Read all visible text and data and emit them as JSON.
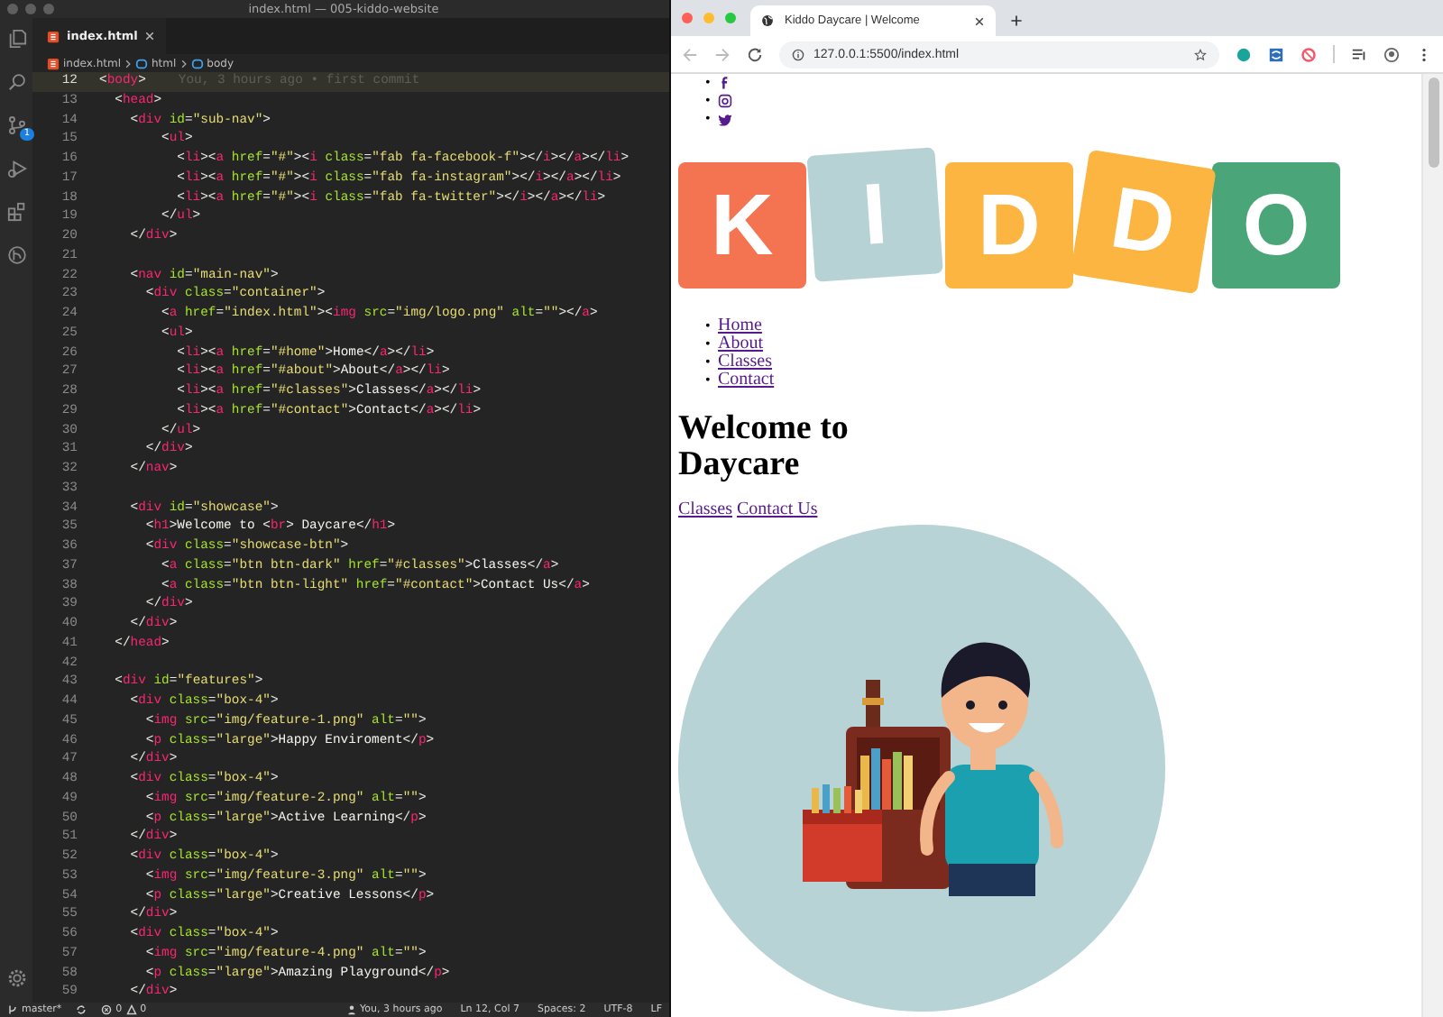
{
  "editor": {
    "window_title": "index.html — 005-kiddo-website",
    "tabs": [
      {
        "label": "index.html",
        "selected": true
      }
    ],
    "breadcrumb": [
      "index.html",
      "html",
      "body"
    ],
    "scm_badge": "1",
    "blame": "You, 3 hours ago • first commit",
    "lines": [
      {
        "number": "12",
        "current": true,
        "tokens": [
          {
            "kind": "punct",
            "text": "<"
          },
          {
            "kind": "tag",
            "text": "body"
          },
          {
            "kind": "punct",
            "text": ">"
          }
        ]
      },
      {
        "number": "13",
        "current": false,
        "tokens": [
          {
            "kind": "punct",
            "text": "  <"
          },
          {
            "kind": "tag",
            "text": "head"
          },
          {
            "kind": "punct",
            "text": ">"
          }
        ]
      },
      {
        "number": "14",
        "current": false,
        "tokens": [
          {
            "kind": "punct",
            "text": "    <"
          },
          {
            "kind": "tag",
            "text": "div"
          },
          {
            "kind": "attr",
            "text": " id"
          },
          {
            "kind": "punct",
            "text": "="
          },
          {
            "kind": "string",
            "text": "\"sub-nav\""
          },
          {
            "kind": "punct",
            "text": ">"
          }
        ]
      },
      {
        "number": "15",
        "current": false,
        "tokens": [
          {
            "kind": "punct",
            "text": "        <"
          },
          {
            "kind": "tag",
            "text": "ul"
          },
          {
            "kind": "punct",
            "text": ">"
          }
        ]
      },
      {
        "number": "16",
        "current": false,
        "tokens": [
          {
            "kind": "punct",
            "text": "          <"
          },
          {
            "kind": "tag",
            "text": "li"
          },
          {
            "kind": "punct",
            "text": "><"
          },
          {
            "kind": "tag",
            "text": "a"
          },
          {
            "kind": "attr",
            "text": " href"
          },
          {
            "kind": "punct",
            "text": "="
          },
          {
            "kind": "string",
            "text": "\"#\""
          },
          {
            "kind": "punct",
            "text": "><"
          },
          {
            "kind": "tag",
            "text": "i"
          },
          {
            "kind": "attr",
            "text": " class"
          },
          {
            "kind": "punct",
            "text": "="
          },
          {
            "kind": "string",
            "text": "\"fab fa-facebook-f\""
          },
          {
            "kind": "punct",
            "text": "></"
          },
          {
            "kind": "tag",
            "text": "i"
          },
          {
            "kind": "punct",
            "text": "></"
          },
          {
            "kind": "tag",
            "text": "a"
          },
          {
            "kind": "punct",
            "text": "></"
          },
          {
            "kind": "tag",
            "text": "li"
          },
          {
            "kind": "punct",
            "text": ">"
          }
        ]
      },
      {
        "number": "17",
        "current": false,
        "tokens": [
          {
            "kind": "punct",
            "text": "          <"
          },
          {
            "kind": "tag",
            "text": "li"
          },
          {
            "kind": "punct",
            "text": "><"
          },
          {
            "kind": "tag",
            "text": "a"
          },
          {
            "kind": "attr",
            "text": " href"
          },
          {
            "kind": "punct",
            "text": "="
          },
          {
            "kind": "string",
            "text": "\"#\""
          },
          {
            "kind": "punct",
            "text": "><"
          },
          {
            "kind": "tag",
            "text": "i"
          },
          {
            "kind": "attr",
            "text": " class"
          },
          {
            "kind": "punct",
            "text": "="
          },
          {
            "kind": "string",
            "text": "\"fab fa-instagram\""
          },
          {
            "kind": "punct",
            "text": "></"
          },
          {
            "kind": "tag",
            "text": "i"
          },
          {
            "kind": "punct",
            "text": "></"
          },
          {
            "kind": "tag",
            "text": "a"
          },
          {
            "kind": "punct",
            "text": "></"
          },
          {
            "kind": "tag",
            "text": "li"
          },
          {
            "kind": "punct",
            "text": ">"
          }
        ]
      },
      {
        "number": "18",
        "current": false,
        "tokens": [
          {
            "kind": "punct",
            "text": "          <"
          },
          {
            "kind": "tag",
            "text": "li"
          },
          {
            "kind": "punct",
            "text": "><"
          },
          {
            "kind": "tag",
            "text": "a"
          },
          {
            "kind": "attr",
            "text": " href"
          },
          {
            "kind": "punct",
            "text": "="
          },
          {
            "kind": "string",
            "text": "\"#\""
          },
          {
            "kind": "punct",
            "text": "><"
          },
          {
            "kind": "tag",
            "text": "i"
          },
          {
            "kind": "attr",
            "text": " class"
          },
          {
            "kind": "punct",
            "text": "="
          },
          {
            "kind": "string",
            "text": "\"fab fa-twitter\""
          },
          {
            "kind": "punct",
            "text": "></"
          },
          {
            "kind": "tag",
            "text": "i"
          },
          {
            "kind": "punct",
            "text": "></"
          },
          {
            "kind": "tag",
            "text": "a"
          },
          {
            "kind": "punct",
            "text": "></"
          },
          {
            "kind": "tag",
            "text": "li"
          },
          {
            "kind": "punct",
            "text": ">"
          }
        ]
      },
      {
        "number": "19",
        "current": false,
        "tokens": [
          {
            "kind": "punct",
            "text": "        </"
          },
          {
            "kind": "tag",
            "text": "ul"
          },
          {
            "kind": "punct",
            "text": ">"
          }
        ]
      },
      {
        "number": "20",
        "current": false,
        "tokens": [
          {
            "kind": "punct",
            "text": "    </"
          },
          {
            "kind": "tag",
            "text": "div"
          },
          {
            "kind": "punct",
            "text": ">"
          }
        ]
      },
      {
        "number": "21",
        "current": false
      },
      {
        "number": "22",
        "current": false,
        "tokens": [
          {
            "kind": "punct",
            "text": "    <"
          },
          {
            "kind": "tag",
            "text": "nav"
          },
          {
            "kind": "attr",
            "text": " id"
          },
          {
            "kind": "punct",
            "text": "="
          },
          {
            "kind": "string",
            "text": "\"main-nav\""
          },
          {
            "kind": "punct",
            "text": ">"
          }
        ]
      },
      {
        "number": "23",
        "current": false,
        "tokens": [
          {
            "kind": "punct",
            "text": "      <"
          },
          {
            "kind": "tag",
            "text": "div"
          },
          {
            "kind": "attr",
            "text": " class"
          },
          {
            "kind": "punct",
            "text": "="
          },
          {
            "kind": "string",
            "text": "\"container\""
          },
          {
            "kind": "punct",
            "text": ">"
          }
        ]
      },
      {
        "number": "24",
        "current": false,
        "tokens": [
          {
            "kind": "punct",
            "text": "        <"
          },
          {
            "kind": "tag",
            "text": "a"
          },
          {
            "kind": "attr",
            "text": " href"
          },
          {
            "kind": "punct",
            "text": "="
          },
          {
            "kind": "string",
            "text": "\""
          },
          {
            "kind": "link",
            "text": "index.html"
          },
          {
            "kind": "string",
            "text": "\""
          },
          {
            "kind": "punct",
            "text": "><"
          },
          {
            "kind": "tag",
            "text": "img"
          },
          {
            "kind": "attr",
            "text": " src"
          },
          {
            "kind": "punct",
            "text": "="
          },
          {
            "kind": "string",
            "text": "\""
          },
          {
            "kind": "link",
            "text": "img/logo.png"
          },
          {
            "kind": "string",
            "text": "\""
          },
          {
            "kind": "attr",
            "text": " alt"
          },
          {
            "kind": "punct",
            "text": "="
          },
          {
            "kind": "string",
            "text": "\"\""
          },
          {
            "kind": "punct",
            "text": "></"
          },
          {
            "kind": "tag",
            "text": "a"
          },
          {
            "kind": "punct",
            "text": ">"
          }
        ]
      },
      {
        "number": "25",
        "current": false,
        "tokens": [
          {
            "kind": "punct",
            "text": "        <"
          },
          {
            "kind": "tag",
            "text": "ul"
          },
          {
            "kind": "punct",
            "text": ">"
          }
        ]
      },
      {
        "number": "26",
        "current": false,
        "tokens": [
          {
            "kind": "punct",
            "text": "          <"
          },
          {
            "kind": "tag",
            "text": "li"
          },
          {
            "kind": "punct",
            "text": "><"
          },
          {
            "kind": "tag",
            "text": "a"
          },
          {
            "kind": "attr",
            "text": " href"
          },
          {
            "kind": "punct",
            "text": "="
          },
          {
            "kind": "string",
            "text": "\""
          },
          {
            "kind": "link",
            "text": "#home"
          },
          {
            "kind": "string",
            "text": "\""
          },
          {
            "kind": "punct",
            "text": ">"
          },
          {
            "kind": "text",
            "text": "Home"
          },
          {
            "kind": "punct",
            "text": "</"
          },
          {
            "kind": "tag",
            "text": "a"
          },
          {
            "kind": "punct",
            "text": "></"
          },
          {
            "kind": "tag",
            "text": "li"
          },
          {
            "kind": "punct",
            "text": ">"
          }
        ]
      },
      {
        "number": "27",
        "current": false,
        "tokens": [
          {
            "kind": "punct",
            "text": "          <"
          },
          {
            "kind": "tag",
            "text": "li"
          },
          {
            "kind": "punct",
            "text": "><"
          },
          {
            "kind": "tag",
            "text": "a"
          },
          {
            "kind": "attr",
            "text": " href"
          },
          {
            "kind": "punct",
            "text": "="
          },
          {
            "kind": "string",
            "text": "\""
          },
          {
            "kind": "link",
            "text": "#about"
          },
          {
            "kind": "string",
            "text": "\""
          },
          {
            "kind": "punct",
            "text": ">"
          },
          {
            "kind": "text",
            "text": "About"
          },
          {
            "kind": "punct",
            "text": "</"
          },
          {
            "kind": "tag",
            "text": "a"
          },
          {
            "kind": "punct",
            "text": "></"
          },
          {
            "kind": "tag",
            "text": "li"
          },
          {
            "kind": "punct",
            "text": ">"
          }
        ]
      },
      {
        "number": "28",
        "current": false,
        "tokens": [
          {
            "kind": "punct",
            "text": "          <"
          },
          {
            "kind": "tag",
            "text": "li"
          },
          {
            "kind": "punct",
            "text": "><"
          },
          {
            "kind": "tag",
            "text": "a"
          },
          {
            "kind": "attr",
            "text": " href"
          },
          {
            "kind": "punct",
            "text": "="
          },
          {
            "kind": "string",
            "text": "\""
          },
          {
            "kind": "link",
            "text": "#classes"
          },
          {
            "kind": "string",
            "text": "\""
          },
          {
            "kind": "punct",
            "text": ">"
          },
          {
            "kind": "text",
            "text": "Classes"
          },
          {
            "kind": "punct",
            "text": "</"
          },
          {
            "kind": "tag",
            "text": "a"
          },
          {
            "kind": "punct",
            "text": "></"
          },
          {
            "kind": "tag",
            "text": "li"
          },
          {
            "kind": "punct",
            "text": ">"
          }
        ]
      },
      {
        "number": "29",
        "current": false,
        "tokens": [
          {
            "kind": "punct",
            "text": "          <"
          },
          {
            "kind": "tag",
            "text": "li"
          },
          {
            "kind": "punct",
            "text": "><"
          },
          {
            "kind": "tag",
            "text": "a"
          },
          {
            "kind": "attr",
            "text": " href"
          },
          {
            "kind": "punct",
            "text": "="
          },
          {
            "kind": "string",
            "text": "\""
          },
          {
            "kind": "link",
            "text": "#contact"
          },
          {
            "kind": "string",
            "text": "\""
          },
          {
            "kind": "punct",
            "text": ">"
          },
          {
            "kind": "text",
            "text": "Contact"
          },
          {
            "kind": "punct",
            "text": "</"
          },
          {
            "kind": "tag",
            "text": "a"
          },
          {
            "kind": "punct",
            "text": "></"
          },
          {
            "kind": "tag",
            "text": "li"
          },
          {
            "kind": "punct",
            "text": ">"
          }
        ]
      },
      {
        "number": "30",
        "current": false,
        "tokens": [
          {
            "kind": "punct",
            "text": "        </"
          },
          {
            "kind": "tag",
            "text": "ul"
          },
          {
            "kind": "punct",
            "text": ">"
          }
        ]
      },
      {
        "number": "31",
        "current": false,
        "tokens": [
          {
            "kind": "punct",
            "text": "      </"
          },
          {
            "kind": "tag",
            "text": "div"
          },
          {
            "kind": "punct",
            "text": ">"
          }
        ]
      },
      {
        "number": "32",
        "current": false,
        "tokens": [
          {
            "kind": "punct",
            "text": "    </"
          },
          {
            "kind": "tag",
            "text": "nav"
          },
          {
            "kind": "punct",
            "text": ">"
          }
        ]
      },
      {
        "number": "33",
        "current": false
      },
      {
        "number": "34",
        "current": false,
        "tokens": [
          {
            "kind": "punct",
            "text": "    <"
          },
          {
            "kind": "tag",
            "text": "div"
          },
          {
            "kind": "attr",
            "text": " id"
          },
          {
            "kind": "punct",
            "text": "="
          },
          {
            "kind": "string",
            "text": "\"showcase\""
          },
          {
            "kind": "punct",
            "text": ">"
          }
        ]
      },
      {
        "number": "35",
        "current": false,
        "tokens": [
          {
            "kind": "punct",
            "text": "      <"
          },
          {
            "kind": "tag",
            "text": "h1"
          },
          {
            "kind": "punct",
            "text": ">"
          },
          {
            "kind": "text",
            "text": "Welcome to "
          },
          {
            "kind": "punct",
            "text": "<"
          },
          {
            "kind": "tag",
            "text": "br"
          },
          {
            "kind": "punct",
            "text": ">"
          },
          {
            "kind": "text",
            "text": " Daycare"
          },
          {
            "kind": "punct",
            "text": "</"
          },
          {
            "kind": "tag",
            "text": "h1"
          },
          {
            "kind": "punct",
            "text": ">"
          }
        ]
      },
      {
        "number": "36",
        "current": false,
        "tokens": [
          {
            "kind": "punct",
            "text": "      <"
          },
          {
            "kind": "tag",
            "text": "div"
          },
          {
            "kind": "attr",
            "text": " class"
          },
          {
            "kind": "punct",
            "text": "="
          },
          {
            "kind": "string",
            "text": "\"showcase-btn\""
          },
          {
            "kind": "punct",
            "text": ">"
          }
        ]
      },
      {
        "number": "37",
        "current": false,
        "tokens": [
          {
            "kind": "punct",
            "text": "        <"
          },
          {
            "kind": "tag",
            "text": "a"
          },
          {
            "kind": "attr",
            "text": " class"
          },
          {
            "kind": "punct",
            "text": "="
          },
          {
            "kind": "string",
            "text": "\"btn btn-dark\""
          },
          {
            "kind": "attr",
            "text": " href"
          },
          {
            "kind": "punct",
            "text": "="
          },
          {
            "kind": "string",
            "text": "\""
          },
          {
            "kind": "link",
            "text": "#classes"
          },
          {
            "kind": "string",
            "text": "\""
          },
          {
            "kind": "punct",
            "text": ">"
          },
          {
            "kind": "text",
            "text": "Classes"
          },
          {
            "kind": "punct",
            "text": "</"
          },
          {
            "kind": "tag",
            "text": "a"
          },
          {
            "kind": "punct",
            "text": ">"
          }
        ]
      },
      {
        "number": "38",
        "current": false,
        "tokens": [
          {
            "kind": "punct",
            "text": "        <"
          },
          {
            "kind": "tag",
            "text": "a"
          },
          {
            "kind": "attr",
            "text": " class"
          },
          {
            "kind": "punct",
            "text": "="
          },
          {
            "kind": "string",
            "text": "\"btn btn-light\""
          },
          {
            "kind": "attr",
            "text": " href"
          },
          {
            "kind": "punct",
            "text": "="
          },
          {
            "kind": "string",
            "text": "\""
          },
          {
            "kind": "link",
            "text": "#contact"
          },
          {
            "kind": "string",
            "text": "\""
          },
          {
            "kind": "punct",
            "text": ">"
          },
          {
            "kind": "text",
            "text": "Contact Us"
          },
          {
            "kind": "punct",
            "text": "</"
          },
          {
            "kind": "tag",
            "text": "a"
          },
          {
            "kind": "punct",
            "text": ">"
          }
        ]
      },
      {
        "number": "39",
        "current": false,
        "tokens": [
          {
            "kind": "punct",
            "text": "      </"
          },
          {
            "kind": "tag",
            "text": "div"
          },
          {
            "kind": "punct",
            "text": ">"
          }
        ]
      },
      {
        "number": "40",
        "current": false,
        "tokens": [
          {
            "kind": "punct",
            "text": "    </"
          },
          {
            "kind": "tag",
            "text": "div"
          },
          {
            "kind": "punct",
            "text": ">"
          }
        ]
      },
      {
        "number": "41",
        "current": false,
        "tokens": [
          {
            "kind": "punct",
            "text": "  </"
          },
          {
            "kind": "tag",
            "text": "head"
          },
          {
            "kind": "punct",
            "text": ">"
          }
        ]
      },
      {
        "number": "42",
        "current": false
      },
      {
        "number": "43",
        "current": false,
        "tokens": [
          {
            "kind": "punct",
            "text": "  <"
          },
          {
            "kind": "tag",
            "text": "div"
          },
          {
            "kind": "attr",
            "text": " id"
          },
          {
            "kind": "punct",
            "text": "="
          },
          {
            "kind": "string",
            "text": "\"features\""
          },
          {
            "kind": "punct",
            "text": ">"
          }
        ]
      },
      {
        "number": "44",
        "current": false,
        "tokens": [
          {
            "kind": "punct",
            "text": "    <"
          },
          {
            "kind": "tag",
            "text": "div"
          },
          {
            "kind": "attr",
            "text": " class"
          },
          {
            "kind": "punct",
            "text": "="
          },
          {
            "kind": "string",
            "text": "\"box-4\""
          },
          {
            "kind": "punct",
            "text": ">"
          }
        ]
      },
      {
        "number": "45",
        "current": false,
        "tokens": [
          {
            "kind": "punct",
            "text": "      <"
          },
          {
            "kind": "tag",
            "text": "img"
          },
          {
            "kind": "attr",
            "text": " src"
          },
          {
            "kind": "punct",
            "text": "="
          },
          {
            "kind": "string",
            "text": "\""
          },
          {
            "kind": "link",
            "text": "img/feature-1.png"
          },
          {
            "kind": "string",
            "text": "\""
          },
          {
            "kind": "attr",
            "text": " alt"
          },
          {
            "kind": "punct",
            "text": "="
          },
          {
            "kind": "string",
            "text": "\"\""
          },
          {
            "kind": "punct",
            "text": ">"
          }
        ]
      },
      {
        "number": "46",
        "current": false,
        "tokens": [
          {
            "kind": "punct",
            "text": "      <"
          },
          {
            "kind": "tag",
            "text": "p"
          },
          {
            "kind": "attr",
            "text": " class"
          },
          {
            "kind": "punct",
            "text": "="
          },
          {
            "kind": "string",
            "text": "\"large\""
          },
          {
            "kind": "punct",
            "text": ">"
          },
          {
            "kind": "text",
            "text": "Happy Enviroment"
          },
          {
            "kind": "punct",
            "text": "</"
          },
          {
            "kind": "tag",
            "text": "p"
          },
          {
            "kind": "punct",
            "text": ">"
          }
        ]
      },
      {
        "number": "47",
        "current": false,
        "tokens": [
          {
            "kind": "punct",
            "text": "    </"
          },
          {
            "kind": "tag",
            "text": "div"
          },
          {
            "kind": "punct",
            "text": ">"
          }
        ]
      },
      {
        "number": "48",
        "current": false,
        "tokens": [
          {
            "kind": "punct",
            "text": "    <"
          },
          {
            "kind": "tag",
            "text": "div"
          },
          {
            "kind": "attr",
            "text": " class"
          },
          {
            "kind": "punct",
            "text": "="
          },
          {
            "kind": "string",
            "text": "\"box-4\""
          },
          {
            "kind": "punct",
            "text": ">"
          }
        ]
      },
      {
        "number": "49",
        "current": false,
        "tokens": [
          {
            "kind": "punct",
            "text": "      <"
          },
          {
            "kind": "tag",
            "text": "img"
          },
          {
            "kind": "attr",
            "text": " src"
          },
          {
            "kind": "punct",
            "text": "="
          },
          {
            "kind": "string",
            "text": "\""
          },
          {
            "kind": "link",
            "text": "img/feature-2.png"
          },
          {
            "kind": "string",
            "text": "\""
          },
          {
            "kind": "attr",
            "text": " alt"
          },
          {
            "kind": "punct",
            "text": "="
          },
          {
            "kind": "string",
            "text": "\"\""
          },
          {
            "kind": "punct",
            "text": ">"
          }
        ]
      },
      {
        "number": "50",
        "current": false,
        "tokens": [
          {
            "kind": "punct",
            "text": "      <"
          },
          {
            "kind": "tag",
            "text": "p"
          },
          {
            "kind": "attr",
            "text": " class"
          },
          {
            "kind": "punct",
            "text": "="
          },
          {
            "kind": "string",
            "text": "\"large\""
          },
          {
            "kind": "punct",
            "text": ">"
          },
          {
            "kind": "text",
            "text": "Active Learning"
          },
          {
            "kind": "punct",
            "text": "</"
          },
          {
            "kind": "tag",
            "text": "p"
          },
          {
            "kind": "punct",
            "text": ">"
          }
        ]
      },
      {
        "number": "51",
        "current": false,
        "tokens": [
          {
            "kind": "punct",
            "text": "    </"
          },
          {
            "kind": "tag",
            "text": "div"
          },
          {
            "kind": "punct",
            "text": ">"
          }
        ]
      },
      {
        "number": "52",
        "current": false,
        "tokens": [
          {
            "kind": "punct",
            "text": "    <"
          },
          {
            "kind": "tag",
            "text": "div"
          },
          {
            "kind": "attr",
            "text": " class"
          },
          {
            "kind": "punct",
            "text": "="
          },
          {
            "kind": "string",
            "text": "\"box-4\""
          },
          {
            "kind": "punct",
            "text": ">"
          }
        ]
      },
      {
        "number": "53",
        "current": false,
        "tokens": [
          {
            "kind": "punct",
            "text": "      <"
          },
          {
            "kind": "tag",
            "text": "img"
          },
          {
            "kind": "attr",
            "text": " src"
          },
          {
            "kind": "punct",
            "text": "="
          },
          {
            "kind": "string",
            "text": "\""
          },
          {
            "kind": "link",
            "text": "img/feature-3.png"
          },
          {
            "kind": "string",
            "text": "\""
          },
          {
            "kind": "attr",
            "text": " alt"
          },
          {
            "kind": "punct",
            "text": "="
          },
          {
            "kind": "string",
            "text": "\"\""
          },
          {
            "kind": "punct",
            "text": ">"
          }
        ]
      },
      {
        "number": "54",
        "current": false,
        "tokens": [
          {
            "kind": "punct",
            "text": "      <"
          },
          {
            "kind": "tag",
            "text": "p"
          },
          {
            "kind": "attr",
            "text": " class"
          },
          {
            "kind": "punct",
            "text": "="
          },
          {
            "kind": "string",
            "text": "\"large\""
          },
          {
            "kind": "punct",
            "text": ">"
          },
          {
            "kind": "text",
            "text": "Creative Lessons"
          },
          {
            "kind": "punct",
            "text": "</"
          },
          {
            "kind": "tag",
            "text": "p"
          },
          {
            "kind": "punct",
            "text": ">"
          }
        ]
      },
      {
        "number": "55",
        "current": false,
        "tokens": [
          {
            "kind": "punct",
            "text": "    </"
          },
          {
            "kind": "tag",
            "text": "div"
          },
          {
            "kind": "punct",
            "text": ">"
          }
        ]
      },
      {
        "number": "56",
        "current": false,
        "tokens": [
          {
            "kind": "punct",
            "text": "    <"
          },
          {
            "kind": "tag",
            "text": "div"
          },
          {
            "kind": "attr",
            "text": " class"
          },
          {
            "kind": "punct",
            "text": "="
          },
          {
            "kind": "string",
            "text": "\"box-4\""
          },
          {
            "kind": "punct",
            "text": ">"
          }
        ]
      },
      {
        "number": "57",
        "current": false,
        "tokens": [
          {
            "kind": "punct",
            "text": "      <"
          },
          {
            "kind": "tag",
            "text": "img"
          },
          {
            "kind": "attr",
            "text": " src"
          },
          {
            "kind": "punct",
            "text": "="
          },
          {
            "kind": "string",
            "text": "\""
          },
          {
            "kind": "link",
            "text": "img/feature-4.png"
          },
          {
            "kind": "string",
            "text": "\""
          },
          {
            "kind": "attr",
            "text": " alt"
          },
          {
            "kind": "punct",
            "text": "="
          },
          {
            "kind": "string",
            "text": "\"\""
          },
          {
            "kind": "punct",
            "text": ">"
          }
        ]
      },
      {
        "number": "58",
        "current": false,
        "tokens": [
          {
            "kind": "punct",
            "text": "      <"
          },
          {
            "kind": "tag",
            "text": "p"
          },
          {
            "kind": "attr",
            "text": " class"
          },
          {
            "kind": "punct",
            "text": "="
          },
          {
            "kind": "string",
            "text": "\"large\""
          },
          {
            "kind": "punct",
            "text": ">"
          },
          {
            "kind": "text",
            "text": "Amazing Playground"
          },
          {
            "kind": "punct",
            "text": "</"
          },
          {
            "kind": "tag",
            "text": "p"
          },
          {
            "kind": "punct",
            "text": ">"
          }
        ]
      },
      {
        "number": "59",
        "current": false,
        "tokens": [
          {
            "kind": "punct",
            "text": "    </"
          },
          {
            "kind": "tag",
            "text": "div"
          },
          {
            "kind": "punct",
            "text": ">"
          }
        ]
      }
    ],
    "status_bar": {
      "branch": "master*",
      "errors": "0",
      "warnings": "0",
      "blame": "You, 3 hours ago",
      "position": "Ln 12, Col 7",
      "spaces": "Spaces: 2",
      "encoding": "UTF-8",
      "eol": "LF"
    }
  },
  "browser": {
    "tabs": [
      {
        "title": "Kiddo Daycare | Welcome",
        "selected": true
      }
    ],
    "url": "127.0.0.1:5500/index.html",
    "page": {
      "social_links": [
        {
          "marker": "•",
          "kind": "facebook"
        },
        {
          "marker": "•",
          "kind": "instagram"
        },
        {
          "marker": "•",
          "kind": "twitter"
        }
      ],
      "logo": [
        {
          "letter": "K",
          "color": "#f47350"
        },
        {
          "letter": "I",
          "color": "#b6d2d4"
        },
        {
          "letter": "D",
          "color": "#fbb540"
        },
        {
          "letter": "D",
          "color": "#fbb540"
        },
        {
          "letter": "O",
          "color": "#4aa678"
        }
      ],
      "nav_links": [
        {
          "marker": "•",
          "label": "Home"
        },
        {
          "marker": "•",
          "label": "About"
        },
        {
          "marker": "•",
          "label": "Classes"
        },
        {
          "marker": "•",
          "label": "Contact"
        }
      ],
      "heading_lines": [
        "Welcome to",
        "Daycare"
      ],
      "links": [
        "Classes",
        "Contact Us"
      ]
    }
  }
}
